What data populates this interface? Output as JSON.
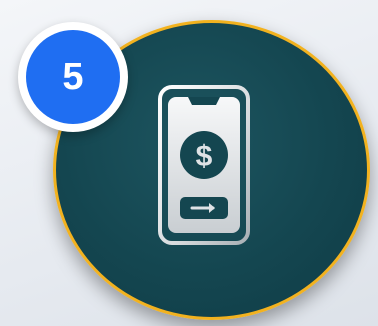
{
  "badge": {
    "number": "5",
    "color": "#1f6ef2"
  },
  "circle": {
    "fill": "#144650",
    "border_color": "#f2b21f"
  },
  "icon": {
    "name": "mobile-payment-icon",
    "parts": [
      "smartphone-icon",
      "dollar-icon",
      "arrow-right-icon"
    ]
  }
}
